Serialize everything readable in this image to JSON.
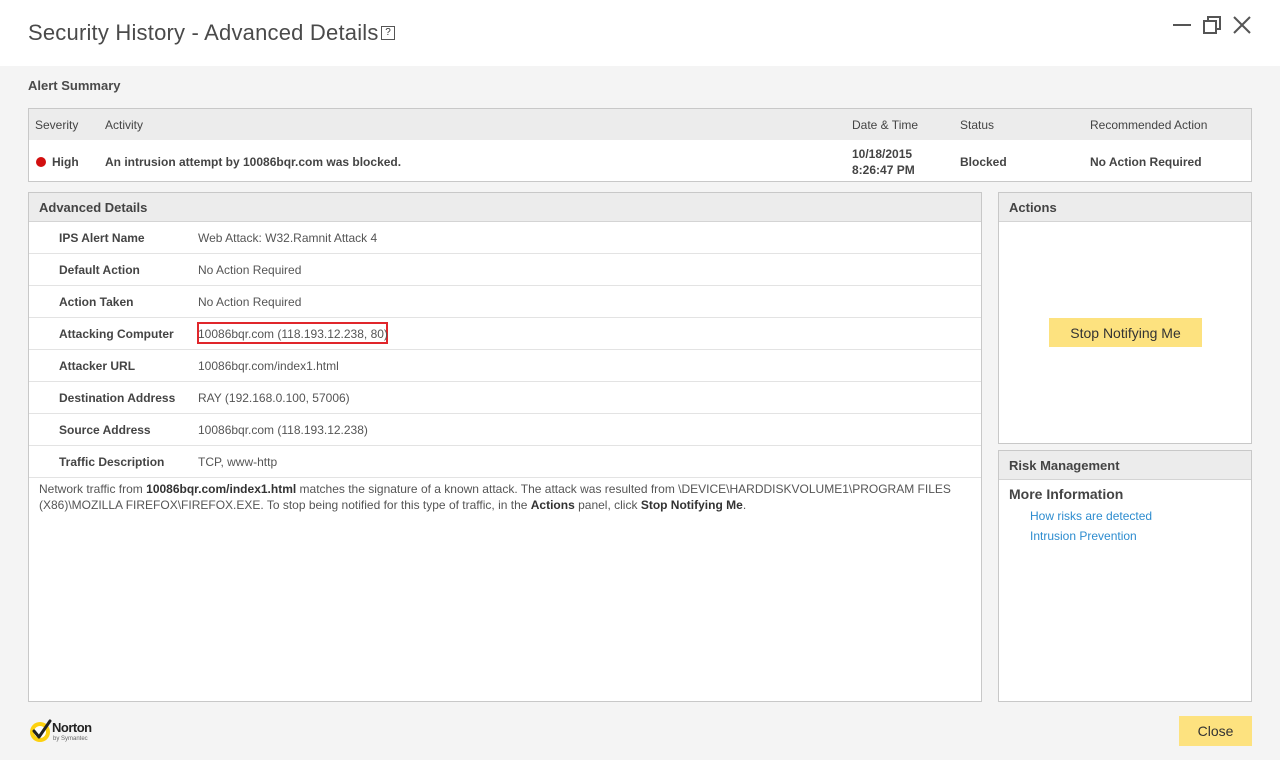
{
  "window": {
    "title": "Security History - Advanced Details",
    "help": "?"
  },
  "alert_summary": {
    "title": "Alert Summary",
    "columns": [
      "Severity",
      "Activity",
      "Date & Time",
      "Status",
      "Recommended Action"
    ],
    "row": {
      "severity": "High",
      "severity_color": "#d20f0f",
      "activity": "An intrusion attempt by 10086bqr.com was blocked.",
      "date": "10/18/2015",
      "time": "8:26:47 PM",
      "status": "Blocked",
      "recommended_action": "No Action Required"
    }
  },
  "advanced_details": {
    "title": "Advanced Details",
    "rows": [
      {
        "label": "IPS Alert Name",
        "value": "Web Attack: W32.Ramnit Attack 4"
      },
      {
        "label": "Default Action",
        "value": "No Action Required"
      },
      {
        "label": "Action Taken",
        "value": "No Action Required"
      },
      {
        "label": "Attacking Computer",
        "value": "10086bqr.com (118.193.12.238, 80)"
      },
      {
        "label": "Attacker URL",
        "value": "10086bqr.com/index1.html"
      },
      {
        "label": "Destination Address",
        "value": "RAY (192.168.0.100, 57006)"
      },
      {
        "label": "Source Address",
        "value": "10086bqr.com (118.193.12.238)"
      },
      {
        "label": "Traffic Description",
        "value": "TCP, www-http"
      }
    ],
    "description": {
      "part1": "Network traffic from ",
      "url": "10086bqr.com/index1.html",
      "part2": " matches the signature of a known attack. The attack was resulted from \\DEVICE\\HARDDISKVOLUME1\\PROGRAM FILES (X86)\\MOZILLA FIREFOX\\FIREFOX.EXE. To stop being notified for this type of traffic, in the ",
      "actions_word": "Actions",
      "part3": " panel, click ",
      "stop_word": "Stop Notifying Me",
      "part4": "."
    }
  },
  "actions": {
    "title": "Actions",
    "stop_button": "Stop Notifying Me"
  },
  "risk_management": {
    "title": "Risk Management",
    "more_info": "More Information",
    "links": [
      "How risks are detected",
      "Intrusion Prevention"
    ]
  },
  "footer": {
    "logo_name": "Norton",
    "logo_sub": "by Symantec",
    "close_button": "Close"
  },
  "colors": {
    "accent_button": "#fde27f",
    "link": "#2d8ccf",
    "highlight_box": "#e0262b"
  }
}
